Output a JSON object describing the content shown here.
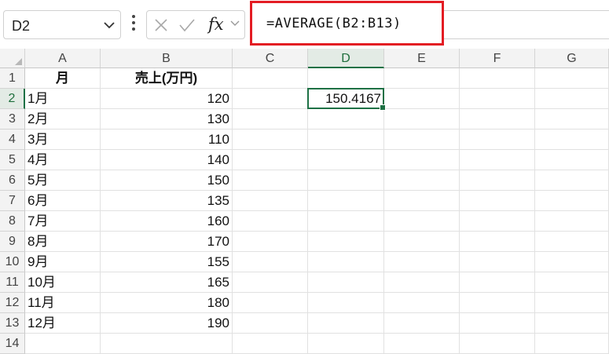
{
  "name_box": {
    "value": "D2"
  },
  "formula_bar": {
    "formula": "=AVERAGE(B2:B13)",
    "fx_label": "fx"
  },
  "icons": [
    "chevron-down-icon",
    "more-vertical-icon",
    "cancel-x-icon",
    "enter-check-icon",
    "function-fx-icon"
  ],
  "colors": {
    "highlight_border": "#e31c23",
    "selection": "#1e7145"
  },
  "columns": [
    "A",
    "B",
    "C",
    "D",
    "E",
    "F",
    "G"
  ],
  "rows": [
    "1",
    "2",
    "3",
    "4",
    "5",
    "6",
    "7",
    "8",
    "9",
    "10",
    "11",
    "12",
    "13",
    "14"
  ],
  "header": {
    "month": "月",
    "sales": "売上(万円)"
  },
  "data_rows": [
    {
      "month": "1月",
      "sales": "120"
    },
    {
      "month": "2月",
      "sales": "130"
    },
    {
      "month": "3月",
      "sales": "110"
    },
    {
      "month": "4月",
      "sales": "140"
    },
    {
      "month": "5月",
      "sales": "150"
    },
    {
      "month": "6月",
      "sales": "135"
    },
    {
      "month": "7月",
      "sales": "160"
    },
    {
      "month": "8月",
      "sales": "170"
    },
    {
      "month": "9月",
      "sales": "155"
    },
    {
      "month": "10月",
      "sales": "165"
    },
    {
      "month": "11月",
      "sales": "180"
    },
    {
      "month": "12月",
      "sales": "190"
    }
  ],
  "result_cell": {
    "address": "D2",
    "value": "150.4167"
  }
}
